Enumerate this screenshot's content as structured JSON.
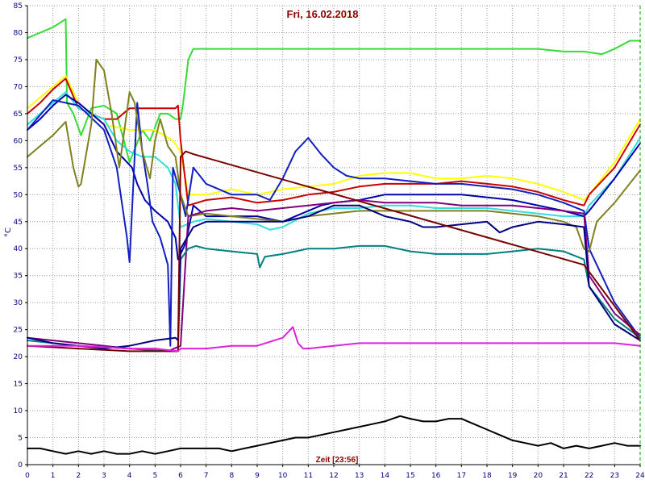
{
  "chart_data": {
    "type": "line",
    "title": "Fri, 16.02.2018",
    "ylabel": "°C",
    "x_note": "Zeit [23:56]",
    "xlim": [
      0,
      24
    ],
    "ylim": [
      0,
      85
    ],
    "x_ticks": [
      0,
      1,
      2,
      3,
      4,
      5,
      6,
      7,
      8,
      9,
      10,
      11,
      12,
      13,
      14,
      15,
      16,
      17,
      18,
      19,
      20,
      21,
      22,
      23,
      24
    ],
    "y_ticks": [
      0,
      5,
      10,
      15,
      20,
      25,
      30,
      35,
      40,
      45,
      50,
      55,
      60,
      65,
      70,
      75,
      80,
      85
    ],
    "grid": true,
    "colors": {
      "grid": "#9a9a9a",
      "axis": "#000000",
      "tick_text": "#000080",
      "title": "#8b0000",
      "current_time_marker": "#00a000"
    },
    "series": [
      {
        "color": "#33dd33",
        "x": [
          0,
          0.5,
          1,
          1.5,
          1.55,
          1.8,
          2.1,
          2.5,
          3,
          3.5,
          4,
          4.5,
          4.8,
          5.2,
          5.5,
          5.8,
          6,
          6.1,
          6.3,
          6.5,
          7,
          10,
          13,
          14,
          16,
          18,
          20,
          21,
          21.8,
          22.5,
          23,
          23.6,
          24
        ],
        "y": [
          79,
          80,
          81,
          82.5,
          67,
          65,
          61,
          66,
          66.5,
          65,
          56,
          62,
          60,
          65,
          65,
          64,
          64,
          67,
          75,
          77,
          77,
          77,
          77,
          77,
          77,
          77,
          77,
          76.5,
          76.5,
          76,
          77,
          78.5,
          78.5
        ]
      },
      {
        "color": "#ffff00",
        "x": [
          0,
          0.5,
          1,
          1.5,
          2,
          2.5,
          3,
          4,
          5,
          5.7,
          6,
          6.3,
          7,
          8,
          9,
          10,
          11,
          12,
          13,
          14,
          15,
          16,
          17,
          18,
          19,
          20,
          21,
          21.8,
          22,
          23,
          24
        ],
        "y": [
          66,
          68,
          70,
          72,
          67,
          65,
          63,
          62,
          62,
          60,
          58,
          50,
          50,
          51,
          50,
          51,
          51.5,
          52,
          53.5,
          54,
          54,
          53,
          53,
          53.5,
          53,
          52,
          50.5,
          49,
          50,
          56,
          64
        ]
      },
      {
        "color": "#cc0000",
        "x": [
          0,
          0.5,
          1,
          1.5,
          2,
          2.5,
          3,
          3.5,
          4,
          5,
          5.8,
          5.9,
          6,
          6.3,
          7,
          8,
          9,
          10,
          11,
          12,
          13,
          14,
          15,
          16,
          17,
          18,
          19,
          20,
          21,
          21.8,
          22,
          23,
          24
        ],
        "y": [
          65,
          67,
          69.5,
          71.5,
          66,
          65,
          64,
          64,
          66,
          66,
          66,
          66.5,
          60,
          48,
          49,
          49.5,
          48.5,
          49,
          50,
          50.5,
          51.5,
          52,
          52,
          52,
          52.5,
          52,
          51.5,
          50.5,
          49,
          48,
          50,
          55,
          63
        ]
      },
      {
        "color": "#33dddd",
        "x": [
          0,
          0.5,
          1,
          1.5,
          2,
          2.5,
          3,
          3.5,
          4,
          4.5,
          5,
          5.5,
          5.8,
          6,
          6.5,
          7,
          8,
          9,
          9.5,
          10,
          11,
          12,
          13,
          14,
          15,
          16,
          17,
          18,
          19,
          20,
          21,
          21.8,
          22,
          23,
          24
        ],
        "y": [
          63,
          65,
          67,
          69,
          66,
          65,
          64,
          60,
          58,
          57,
          57,
          55,
          52,
          44,
          45,
          45.5,
          45,
          44.5,
          43.5,
          44,
          46.5,
          47.5,
          47.5,
          48,
          48,
          47.5,
          47.5,
          47.5,
          47,
          46.5,
          46,
          46,
          48,
          53,
          60.5
        ]
      },
      {
        "color": "#0000aa",
        "x": [
          0,
          0.5,
          1,
          1.5,
          2,
          2.5,
          3,
          3.5,
          3.9,
          4.1,
          4.3,
          4.6,
          5.0,
          5.5,
          5.8,
          5.9,
          6.2,
          6.5,
          7,
          8,
          9,
          10,
          10.5,
          11,
          11.5,
          12,
          13,
          14,
          15,
          16,
          17,
          18,
          19,
          20,
          21,
          21.8,
          22,
          23,
          24
        ],
        "y": [
          62,
          64,
          66.5,
          68.5,
          67,
          65,
          63,
          58,
          56,
          55,
          52,
          49,
          47,
          45,
          42,
          38,
          41,
          48,
          46,
          46,
          46,
          45,
          46,
          47,
          48,
          48.5,
          49,
          50,
          50,
          50,
          50,
          49.5,
          49,
          48,
          47,
          46,
          47,
          53,
          59.5
        ]
      },
      {
        "color": "#1020c0",
        "x": [
          0,
          1,
          2,
          3,
          3.5,
          3.9,
          4,
          4.3,
          4.5,
          4.7,
          4.9,
          5.2,
          5.5,
          5.6,
          5.7,
          6.0,
          6.2,
          6.5,
          7,
          8,
          9,
          9.5,
          10,
          10.5,
          11,
          11.5,
          12,
          12.5,
          13,
          14,
          15,
          16,
          17,
          18,
          19,
          20,
          21,
          21.8,
          22,
          23,
          24
        ],
        "y": [
          62,
          67.5,
          66.5,
          62,
          55,
          42,
          37.5,
          67,
          58,
          52,
          45,
          42,
          37,
          22,
          55,
          50,
          46,
          55,
          52,
          50,
          50,
          49,
          53,
          58,
          60.5,
          57.5,
          55,
          53.5,
          53,
          53,
          52.5,
          52,
          52,
          51.5,
          51,
          50,
          48.5,
          47,
          40,
          30,
          23.5
        ]
      },
      {
        "color": "#808020",
        "x": [
          0,
          0.5,
          1,
          1.5,
          1.8,
          2,
          2.1,
          2.5,
          2.7,
          3,
          3.3,
          3.6,
          4,
          4.2,
          4.5,
          4.8,
          5,
          5.2,
          5.5,
          5.8,
          6,
          6.3,
          7,
          8,
          9,
          10,
          11,
          12,
          13,
          14,
          15,
          16,
          17,
          18,
          19,
          20,
          21,
          21.5,
          21.8,
          22,
          22.3,
          23,
          24
        ],
        "y": [
          57,
          59,
          61,
          63.5,
          55,
          51.5,
          52,
          63,
          75,
          73,
          65,
          55,
          69,
          67,
          58,
          53,
          60,
          64,
          59,
          57,
          50,
          46,
          46.5,
          46,
          45.5,
          45,
          46,
          46.5,
          47,
          47,
          47,
          47,
          47,
          47,
          46.5,
          46,
          45,
          44,
          40,
          39.5,
          45,
          48.5,
          54.5
        ]
      },
      {
        "color": "#800080",
        "x": [
          0,
          2,
          4,
          5.5,
          6,
          6.3,
          7,
          8,
          9,
          10,
          11,
          12,
          13,
          14,
          15,
          16,
          17,
          18,
          19,
          20,
          21,
          21.8,
          22,
          23,
          24
        ],
        "y": [
          23.5,
          22.5,
          21.5,
          21,
          22,
          46,
          47,
          47.5,
          47,
          47.5,
          48,
          48.5,
          49,
          48.5,
          48.5,
          48.5,
          48,
          48,
          48,
          47.5,
          47,
          46.5,
          35,
          28,
          24
        ]
      },
      {
        "color": "#008080",
        "x": [
          0,
          2,
          4,
          5.5,
          5.9,
          6,
          6.3,
          6.6,
          7,
          8,
          9,
          9.1,
          9.3,
          10,
          10.5,
          11,
          12,
          13,
          14,
          15,
          16,
          17,
          18,
          19,
          20,
          21,
          21.8,
          22,
          23,
          24
        ],
        "y": [
          23,
          22,
          21.5,
          21,
          21,
          38,
          40,
          40.5,
          40,
          39.5,
          39,
          36.5,
          38.5,
          39,
          39.5,
          40,
          40,
          40.5,
          40.5,
          39.5,
          39,
          39,
          39,
          39.5,
          40,
          39.5,
          38,
          33,
          27,
          23.5
        ]
      },
      {
        "color": "#000080",
        "x": [
          0,
          1,
          2,
          3,
          4,
          5,
          5.8,
          5.9,
          6,
          6.5,
          7,
          8,
          9,
          10,
          11,
          12,
          13,
          14,
          15,
          15.5,
          16,
          17,
          18,
          18.5,
          19,
          20,
          21,
          21.8,
          22,
          23,
          24
        ],
        "y": [
          23.5,
          22.5,
          22,
          21.5,
          22,
          23,
          23.5,
          23,
          40,
          44,
          45,
          45,
          45,
          45,
          46,
          48,
          48,
          46,
          45,
          44,
          44,
          44.5,
          45,
          43,
          44,
          45,
          44.5,
          44,
          33,
          26,
          23
        ]
      },
      {
        "color": "#7a0000",
        "x": [
          0,
          2,
          4,
          5.9,
          6.0,
          6.2,
          6.5,
          21.8,
          24
        ],
        "y": [
          22,
          21.5,
          21,
          21,
          57,
          58,
          57.5,
          37,
          23
        ]
      },
      {
        "color": "#dd22dd",
        "x": [
          0,
          2,
          4,
          5,
          5.9,
          6,
          7,
          8,
          9,
          10,
          10.4,
          10.6,
          10.8,
          11,
          12,
          13,
          14,
          15,
          16,
          17,
          18,
          19,
          20,
          21,
          22,
          23,
          24
        ],
        "y": [
          22,
          22,
          21.5,
          21.5,
          21,
          21.5,
          21.5,
          22,
          22,
          23.5,
          25.5,
          22.5,
          21.5,
          21.5,
          22,
          22.5,
          22.5,
          22.5,
          22.5,
          22.5,
          22.5,
          22.5,
          22.5,
          22.5,
          22.5,
          22.5,
          22
        ]
      },
      {
        "color": "#000000",
        "x": [
          0,
          0.5,
          1,
          1.5,
          2,
          2.5,
          3,
          3.5,
          4,
          4.5,
          5,
          5.5,
          6,
          6.5,
          7,
          7.5,
          8,
          8.5,
          9,
          9.5,
          10,
          10.5,
          11,
          11.5,
          12,
          12.5,
          13,
          13.5,
          14,
          14.3,
          14.6,
          15,
          15.5,
          16,
          16.5,
          17,
          17.5,
          18,
          18.5,
          19,
          19.5,
          20,
          20.5,
          21,
          21.5,
          22,
          22.5,
          23,
          23.5,
          24
        ],
        "y": [
          3,
          3,
          2.5,
          2,
          2.5,
          2,
          2.5,
          2,
          2,
          2.5,
          2,
          2.5,
          3,
          3,
          3,
          3,
          2.5,
          3,
          3.5,
          4,
          4.5,
          5,
          5,
          5.5,
          6,
          6.5,
          7,
          7.5,
          8,
          8.5,
          9,
          8.5,
          8,
          8,
          8.5,
          8.5,
          7.5,
          6.5,
          5.5,
          4.5,
          4,
          3.5,
          4,
          3,
          3.5,
          3,
          3.5,
          4,
          3.5,
          3.5
        ]
      }
    ]
  }
}
